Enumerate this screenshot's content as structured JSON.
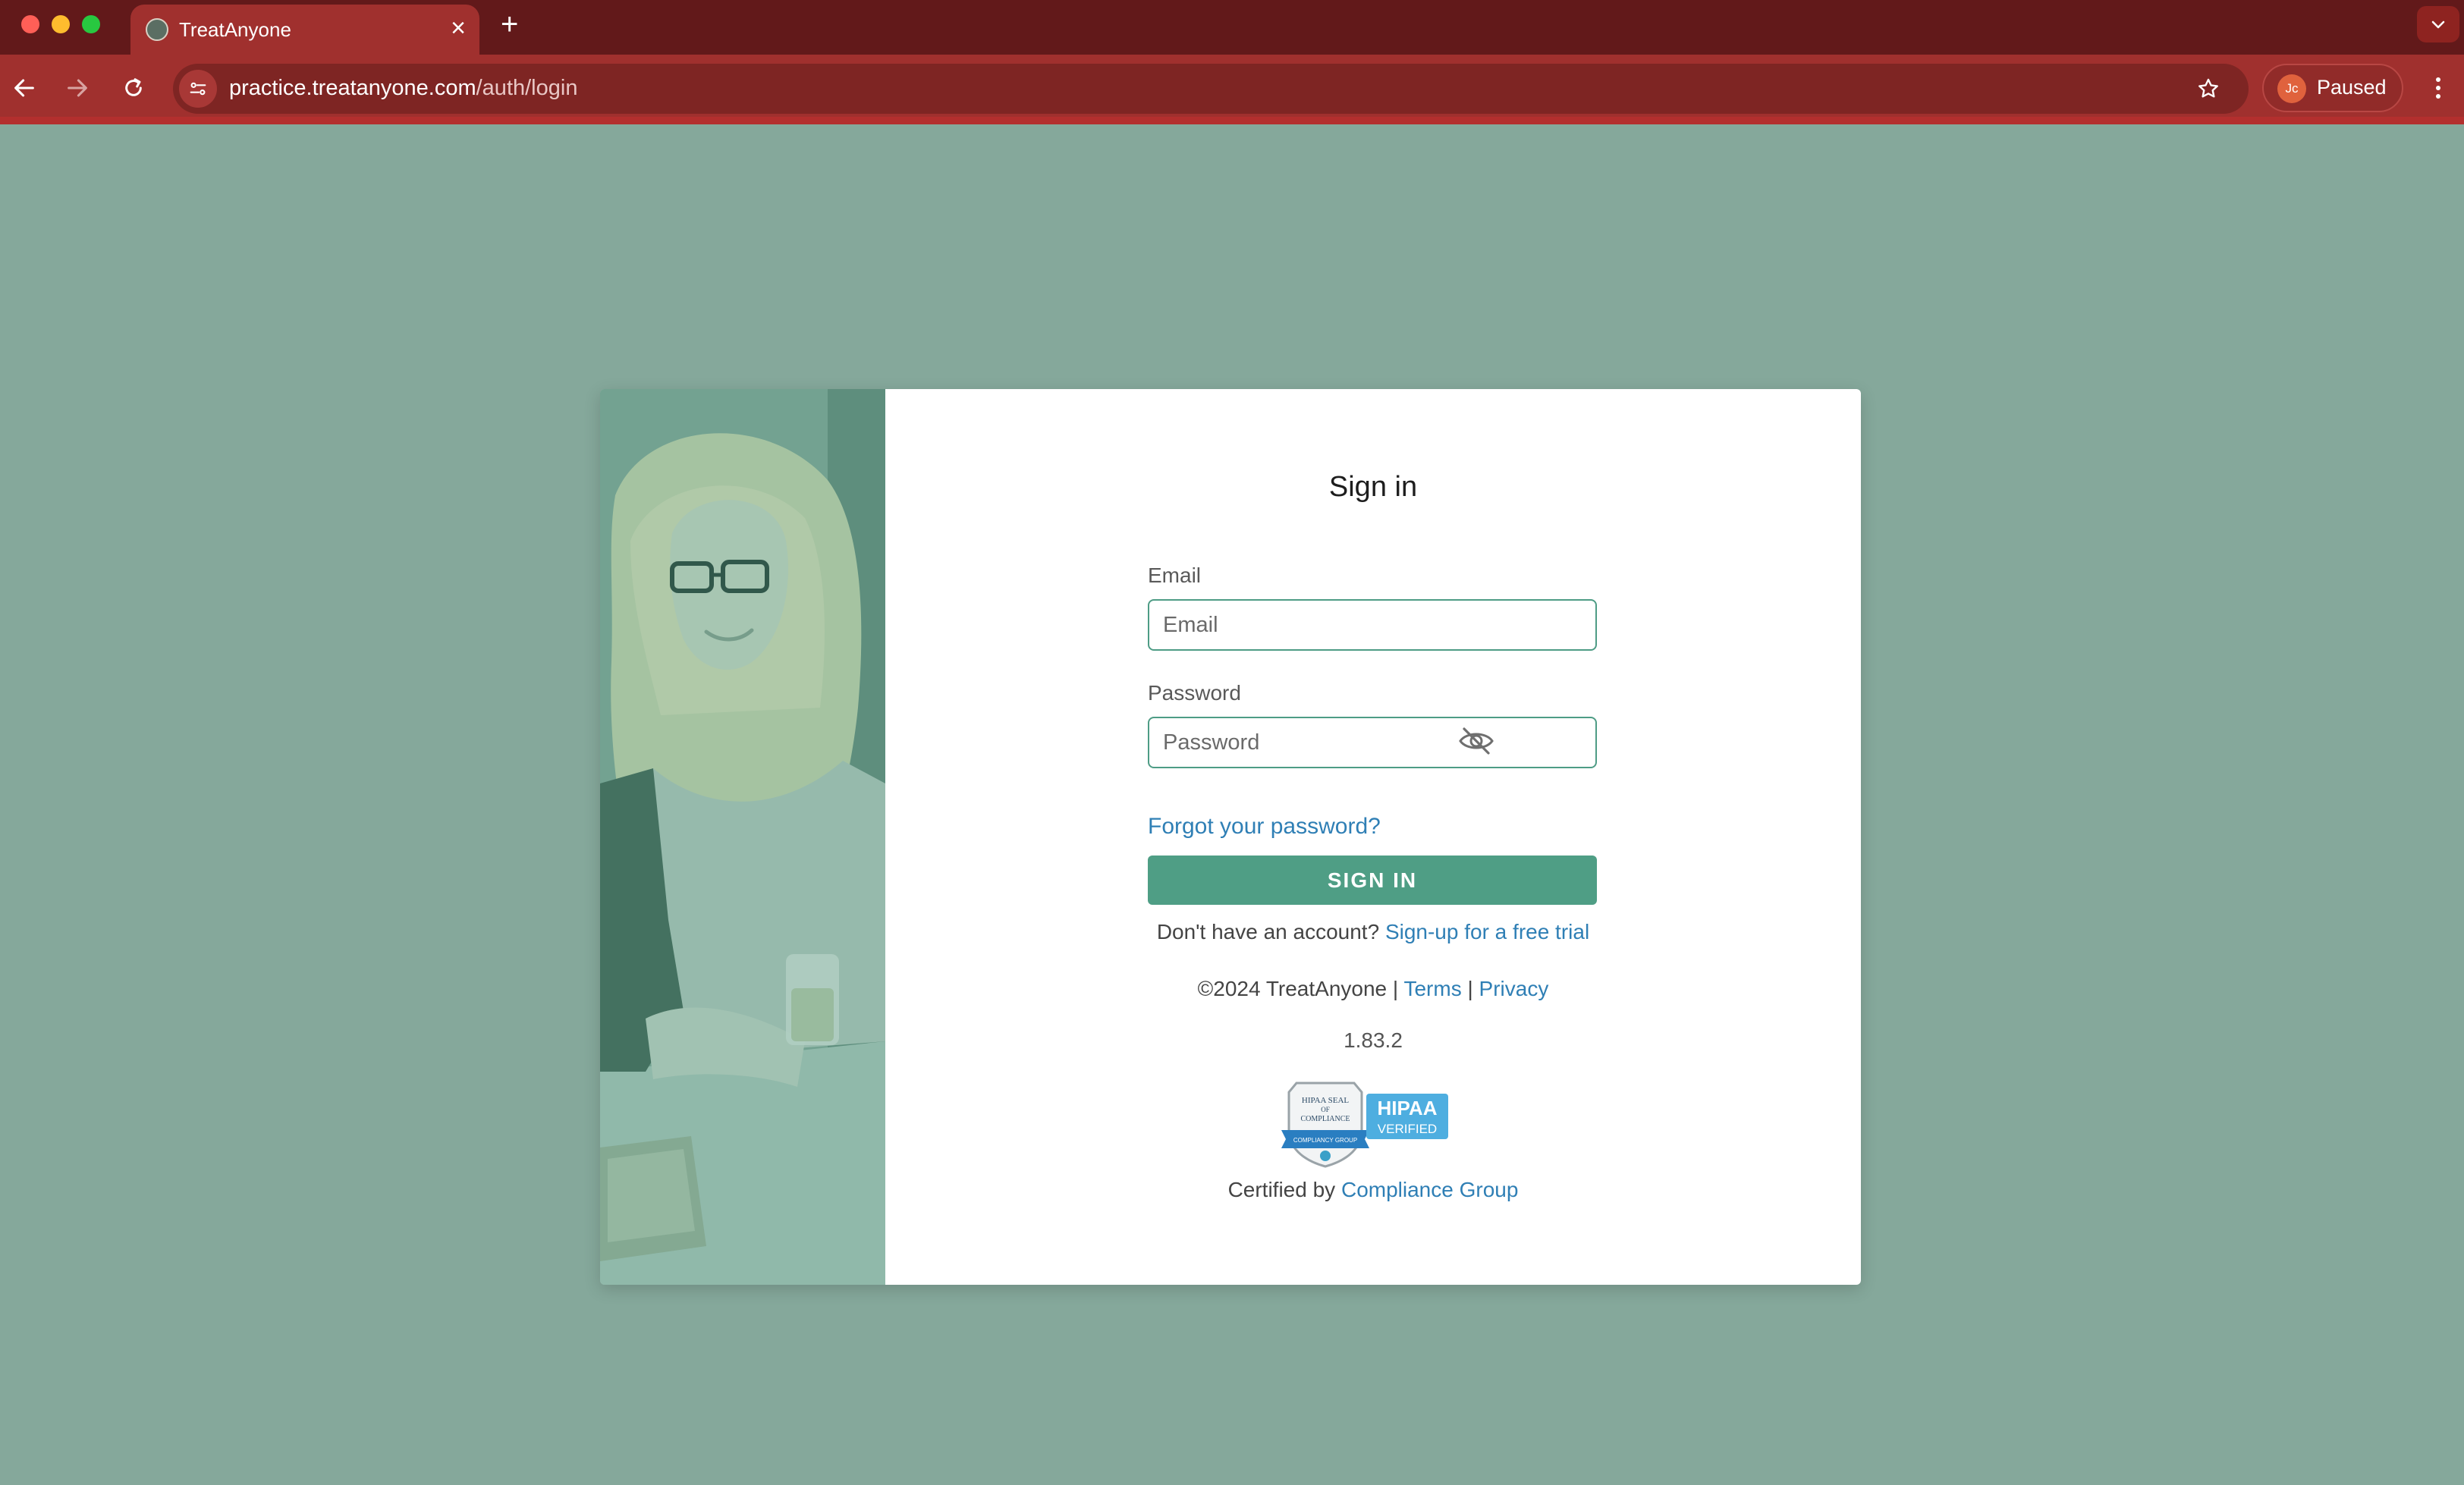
{
  "browser": {
    "tab_title": "TreatAnyone",
    "url_host": "practice.treatanyone.com",
    "url_path": "/auth/login",
    "profile_initials": "Jc",
    "profile_status": "Paused"
  },
  "login": {
    "title": "Sign in",
    "email_label": "Email",
    "email_placeholder": "Email",
    "password_label": "Password",
    "password_placeholder": "Password",
    "forgot_password": "Forgot your password?",
    "sign_in_button": "SIGN IN",
    "no_account_text": "Don't have an account?",
    "signup_link": "Sign-up for a free trial",
    "copyright": "©2024 TreatAnyone |",
    "terms_link": "Terms",
    "separator": "|",
    "privacy_link": "Privacy",
    "version": "1.83.2",
    "seal_text_top": "HIPAA SEAL OF COMPLIANCE",
    "seal_ribbon_text": "COMPLIANCY GROUP",
    "seal_badge_line1": "HIPAA",
    "seal_badge_line2": "VERIFIED",
    "certified_text": "Certified by",
    "certified_link": "Compliance Group"
  },
  "colors": {
    "page_bg": "#85a89b",
    "accent_green": "#4f9e85",
    "link_blue": "#2f7fb5",
    "chrome_dark": "#62191a",
    "chrome_tab": "#a0302e"
  },
  "icons": {
    "back": "arrow-left",
    "forward": "arrow-right",
    "reload": "reload",
    "site_info": "tune",
    "bookmark": "star",
    "menu": "kebab",
    "password_toggle": "eye-off"
  }
}
